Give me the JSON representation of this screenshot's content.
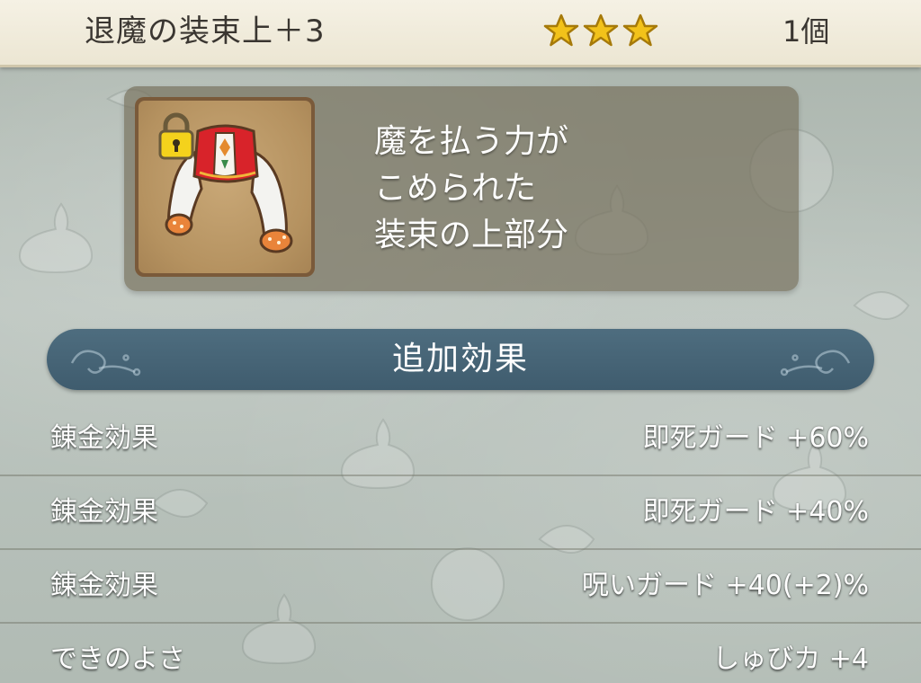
{
  "header": {
    "item_name": "退魔の装束上＋3",
    "star_count": 3,
    "star_color": "#f2c21a",
    "quantity": "1個"
  },
  "item": {
    "icon": "red-white-robe-top-icon",
    "locked": true,
    "lock_icon": "padlock-icon",
    "description": [
      "魔を払う力が",
      "こめられた",
      "装束の上部分"
    ]
  },
  "section": {
    "title": "追加効果",
    "banner_color": "#466577"
  },
  "effects": [
    {
      "label": "錬金効果",
      "value": "即死ガード +60%"
    },
    {
      "label": "錬金効果",
      "value": "即死ガード +40%"
    },
    {
      "label": "錬金効果",
      "value": "呪いガード +40(+2)%"
    },
    {
      "label": "できのよさ",
      "value": "しゅびカ +4"
    }
  ]
}
